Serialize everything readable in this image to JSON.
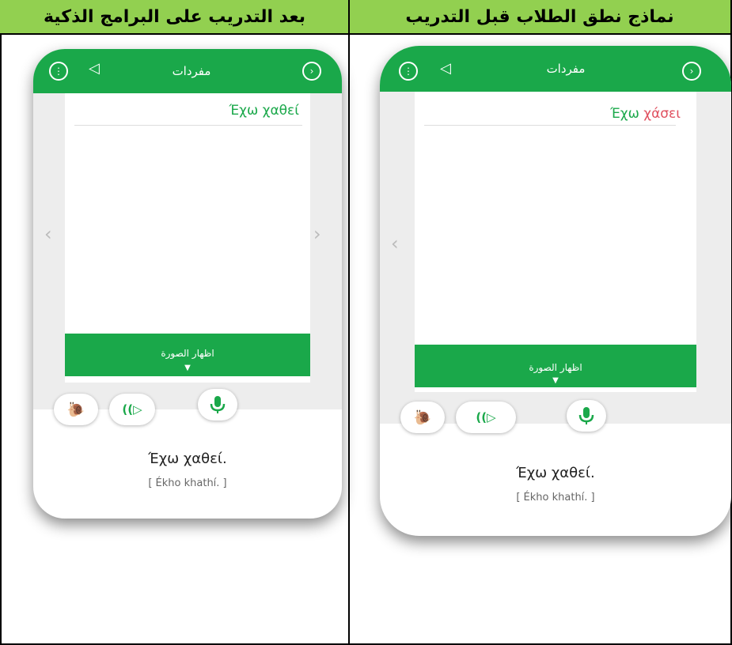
{
  "headers": {
    "after": "بعد التدريب على البرامج الذكية",
    "before": "نماذج نطق الطلاب قبل التدريب"
  },
  "phones": {
    "after": {
      "title": "مفردات",
      "word_prefix": "Έχω",
      "word_answer": "χαθεί",
      "show_image": "اظهار الصورة",
      "sentence": "Έχω χαθεί.",
      "transliteration": "[ Ékho khathí. ]"
    },
    "before": {
      "title": "مفردات",
      "word_prefix": "Έχω",
      "word_answer": "χάσει",
      "show_image": "اظهار الصورة",
      "sentence": "Έχω χαθεί.",
      "transliteration": "[ Ékho khathí. ]"
    }
  },
  "colors": {
    "header_bg": "#92D050",
    "app_green": "#1aa84a",
    "wrong_red": "#e0505f"
  }
}
